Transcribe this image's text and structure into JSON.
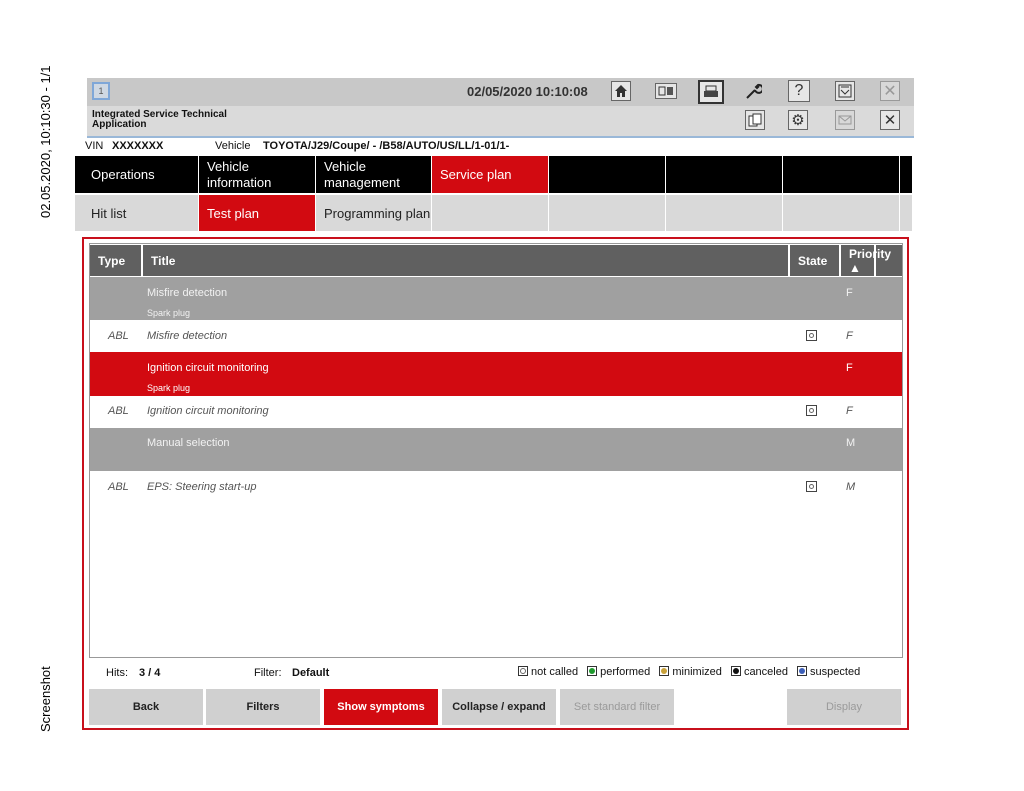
{
  "side": {
    "left_timestamp": "02.05.2020, 10:10:30 - 1/1",
    "left_caption": "Screenshot"
  },
  "topbar": {
    "window_number": "1",
    "datetime": "02/05/2020 10:10:08",
    "icons": [
      "home-icon",
      "screen-toggle-icon",
      "print-icon",
      "wrench-icon",
      "help-icon",
      "download-icon",
      "close-icon"
    ]
  },
  "app": {
    "name": "Integrated Service Technical Application",
    "icons": [
      "documents-icon",
      "gear-icon",
      "mail-icon",
      "close-icon"
    ]
  },
  "vehicle_row": {
    "vin_label": "VIN",
    "vin_value": "XXXXXXX",
    "vehicle_label": "Vehicle",
    "vehicle_value": "TOYOTA/J29/Coupe/ - /B58/AUTO/US/LL/1-01/1-"
  },
  "tabs_main": [
    {
      "label": "Operations"
    },
    {
      "label": "Vehicle information"
    },
    {
      "label": "Vehicle management"
    },
    {
      "label": "Service plan"
    }
  ],
  "tabs_sub": [
    {
      "label": "Hit list"
    },
    {
      "label": "Test plan"
    },
    {
      "label": "Programming plan"
    }
  ],
  "table": {
    "columns": {
      "type": "Type",
      "title": "Title",
      "state": "State",
      "priority": "Priority ▲"
    },
    "rows": [
      {
        "type": "",
        "title": "Misfire detection",
        "subtitle": "Spark plug",
        "priority": "F"
      },
      {
        "type": "ABL",
        "title": "Misfire detection",
        "subtitle": "",
        "priority": "F"
      },
      {
        "type": "",
        "title": "Ignition circuit monitoring",
        "subtitle": "Spark plug",
        "priority": "F"
      },
      {
        "type": "ABL",
        "title": "Ignition circuit monitoring",
        "subtitle": "",
        "priority": "F"
      },
      {
        "type": "",
        "title": "Manual selection",
        "subtitle": "",
        "priority": "M"
      },
      {
        "type": "ABL",
        "title": "EPS: Steering start-up",
        "subtitle": "",
        "priority": "M"
      }
    ]
  },
  "footer": {
    "hits_label": "Hits:",
    "hits_value": "3 / 4",
    "filter_label": "Filter:",
    "filter_value": "Default",
    "legend": [
      {
        "label": "not called",
        "color": "#ffffff"
      },
      {
        "label": "performed",
        "color": "#1f9a2e"
      },
      {
        "label": "minimized",
        "color": "#c9a13a"
      },
      {
        "label": "canceled",
        "color": "#111111"
      },
      {
        "label": "suspected",
        "color": "#3d5fb8"
      }
    ]
  },
  "buttons": {
    "back": "Back",
    "filters": "Filters",
    "show_symptoms": "Show symptoms",
    "collapse_expand": "Collapse / expand",
    "set_standard_filter": "Set standard filter",
    "display": "Display"
  },
  "colors": {
    "accent_red": "#d20a11",
    "header_grey": "#606060",
    "row_grey": "#a0a0a0"
  }
}
